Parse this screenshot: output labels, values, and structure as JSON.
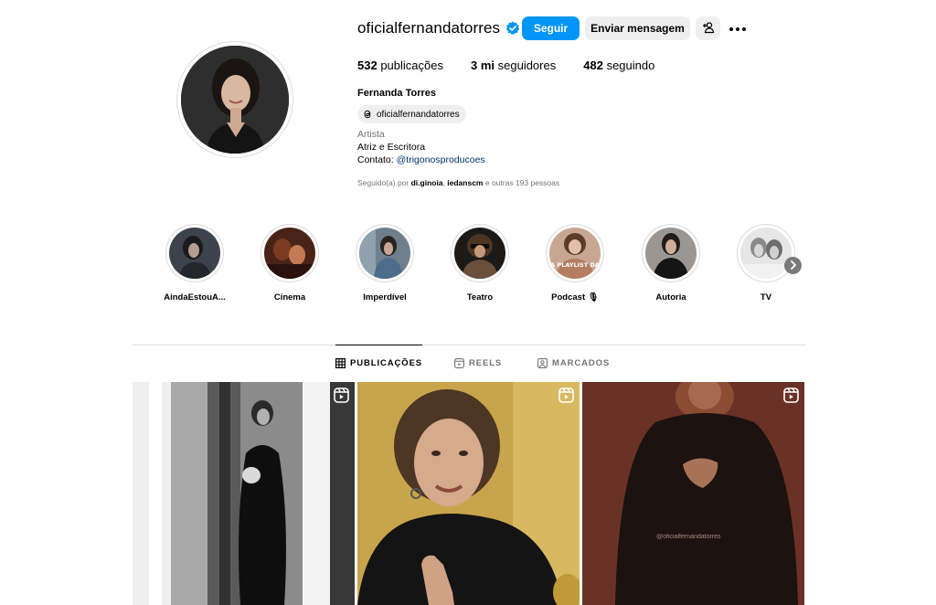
{
  "profile": {
    "username": "oficialfernandatorres",
    "verified": true,
    "follow_label": "Seguir",
    "message_label": "Enviar mensagem",
    "stats": {
      "posts_count": "532",
      "posts_label": "publicações",
      "followers_count": "3 mi",
      "followers_label": "seguidores",
      "following_count": "482",
      "following_label": "seguindo"
    },
    "full_name": "Fernanda Torres",
    "threads_handle": "oficialfernandatorres",
    "category": "Artista",
    "bio_line1": "Atriz e Escritora",
    "bio_contact_prefix": "Contato: ",
    "bio_contact_link": "@trigonosproducoes",
    "followed_by_prefix": "Seguido(a) por ",
    "followed_by_user1": "di.ginoia",
    "followed_by_sep": ", ",
    "followed_by_user2": "iedanscm",
    "followed_by_suffix": " e outras 193 pessoas"
  },
  "highlights": [
    {
      "label": "AindaEstouA..."
    },
    {
      "label": "Cinema"
    },
    {
      "label": "Imperdível"
    },
    {
      "label": "Teatro"
    },
    {
      "label": "Podcast 🎙"
    },
    {
      "label": "Autoria"
    },
    {
      "label": "TV"
    }
  ],
  "highlight_overlay_text": "A PLAYLIST DA",
  "tabs": [
    {
      "label": "PUBLICAÇÕES",
      "active": true
    },
    {
      "label": "REELS",
      "active": false
    },
    {
      "label": "MARCADOS",
      "active": false
    }
  ],
  "posts": [
    {
      "type": "reel"
    },
    {
      "type": "reel"
    },
    {
      "type": "reel",
      "watermark": "@oficialfernandatorres"
    }
  ],
  "colors": {
    "accent": "#0095f6",
    "secondary_button": "#efefef",
    "muted_text": "#737373",
    "link": "#00376b"
  }
}
